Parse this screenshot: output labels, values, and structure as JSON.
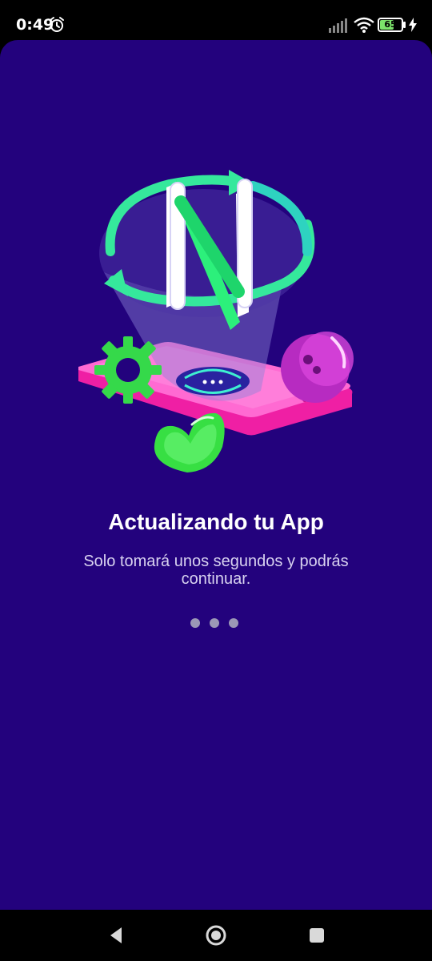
{
  "status_bar": {
    "time": "0:49",
    "battery_level": "65",
    "icons": [
      "alarm-icon",
      "signal-icon",
      "wifi-icon",
      "battery-icon",
      "charging-icon"
    ]
  },
  "main": {
    "illustration": "app-update-illustration",
    "title": "Actualizando tu App",
    "subtitle": "Solo tomará unos segundos y podrás continuar.",
    "progress_dots": 3
  },
  "nav_bar": {
    "icons": [
      "back-icon",
      "home-icon",
      "recents-icon"
    ]
  },
  "colors": {
    "background": "#23027d",
    "accent_green": "#35e89c",
    "accent_pink": "#ff49c8",
    "text_primary": "#ffffff",
    "text_secondary": "#d8d2f0"
  }
}
